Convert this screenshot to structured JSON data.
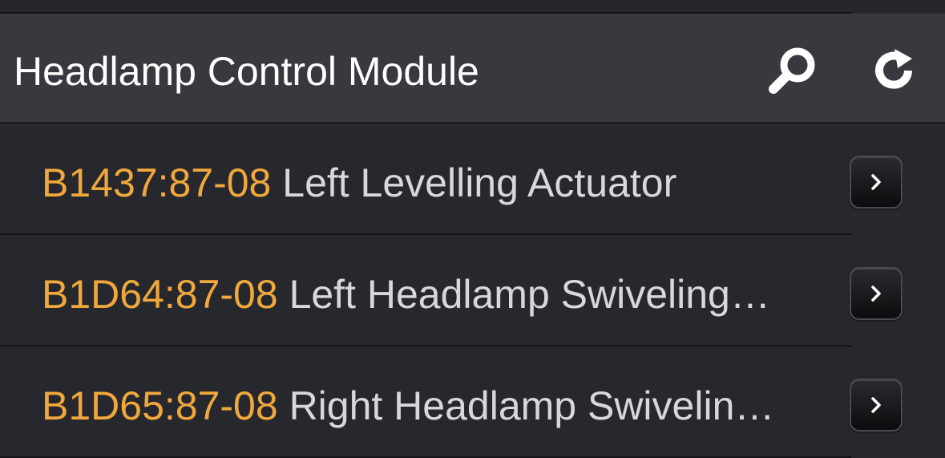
{
  "header": {
    "title": "Headlamp Control Module",
    "search_icon": "search-icon",
    "refresh_icon": "refresh-icon"
  },
  "dtc_list": {
    "items": [
      {
        "code": "B1437:87-08",
        "description": "Left Levelling Actuator"
      },
      {
        "code": "B1D64:87-08",
        "description": "Left Headlamp Swiveling…"
      },
      {
        "code": "B1D65:87-08",
        "description": "Right Headlamp Swivelin…"
      }
    ],
    "disclosure_icon": "chevron-right-icon"
  },
  "colors": {
    "background": "#27282d",
    "header_background": "#38393e",
    "code_text": "#f0a83c",
    "description_text": "#d7d8dc",
    "title_text": "#ffffff"
  }
}
